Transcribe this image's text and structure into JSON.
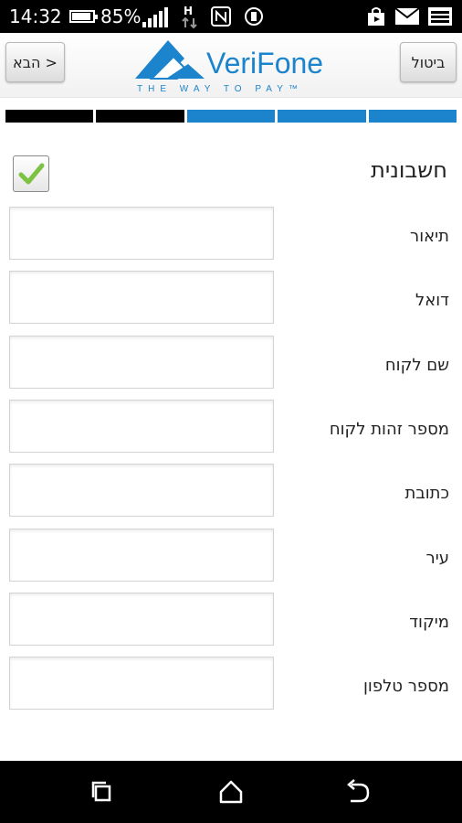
{
  "status_bar": {
    "time": "14:32",
    "battery_percent": "85%",
    "signal_icon": "signal-icon",
    "network_icon": "h-plus-icon",
    "nfc_icon": "nfc-icon",
    "rotate_icon": "screen-rotate-icon",
    "right_icons": [
      "store-icon",
      "mail-icon",
      "notification-icon"
    ]
  },
  "header": {
    "next_label": "הבא >",
    "cancel_label": "ביטול",
    "logo_text": "VeriFone",
    "logo_tagline": "THE WAY TO PAY™"
  },
  "progress": {
    "segments": [
      "complete",
      "complete",
      "pending",
      "pending",
      "pending"
    ],
    "colors": {
      "complete": "#000000",
      "pending": "#1c84cc"
    }
  },
  "form": {
    "title": "חשבונית",
    "invoice_checked": true,
    "fields": [
      {
        "label": "תיאור",
        "value": ""
      },
      {
        "label": "דואל",
        "value": ""
      },
      {
        "label": "שם לקוח",
        "value": ""
      },
      {
        "label": "מספר זהות לקוח",
        "value": ""
      },
      {
        "label": "כתובת",
        "value": ""
      },
      {
        "label": "עיר",
        "value": ""
      },
      {
        "label": "מיקוד",
        "value": ""
      },
      {
        "label": "מספר טלפון",
        "value": ""
      }
    ]
  },
  "nav_bar": {
    "buttons": [
      "recent-apps-icon",
      "home-icon",
      "back-icon"
    ]
  },
  "colors": {
    "brand_blue": "#1c84cc",
    "check_green": "#7dc242"
  }
}
